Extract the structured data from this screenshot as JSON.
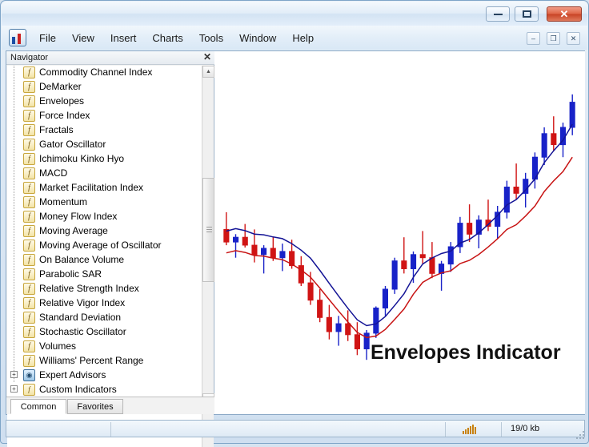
{
  "window": {
    "title": "",
    "buttons": {
      "minimize": "minimize",
      "maximize": "maximize",
      "close": "✕"
    }
  },
  "menu": {
    "items": [
      {
        "label": "File"
      },
      {
        "label": "View"
      },
      {
        "label": "Insert"
      },
      {
        "label": "Charts"
      },
      {
        "label": "Tools"
      },
      {
        "label": "Window"
      },
      {
        "label": "Help"
      }
    ],
    "mdi_buttons": {
      "minimize": "–",
      "restore": "❐",
      "close": "✕"
    }
  },
  "navigator": {
    "title": "Navigator",
    "close_label": "✕",
    "indicator_glyph": "f",
    "items": [
      {
        "label": "Commodity Channel Index",
        "type": "indicator"
      },
      {
        "label": "DeMarker",
        "type": "indicator"
      },
      {
        "label": "Envelopes",
        "type": "indicator"
      },
      {
        "label": "Force Index",
        "type": "indicator"
      },
      {
        "label": "Fractals",
        "type": "indicator"
      },
      {
        "label": "Gator Oscillator",
        "type": "indicator"
      },
      {
        "label": "Ichimoku Kinko Hyo",
        "type": "indicator"
      },
      {
        "label": "MACD",
        "type": "indicator"
      },
      {
        "label": "Market Facilitation Index",
        "type": "indicator"
      },
      {
        "label": "Momentum",
        "type": "indicator"
      },
      {
        "label": "Money Flow Index",
        "type": "indicator"
      },
      {
        "label": "Moving Average",
        "type": "indicator"
      },
      {
        "label": "Moving Average of Oscillator",
        "type": "indicator"
      },
      {
        "label": "On Balance Volume",
        "type": "indicator"
      },
      {
        "label": "Parabolic SAR",
        "type": "indicator"
      },
      {
        "label": "Relative Strength Index",
        "type": "indicator"
      },
      {
        "label": "Relative Vigor Index",
        "type": "indicator"
      },
      {
        "label": "Standard Deviation",
        "type": "indicator"
      },
      {
        "label": "Stochastic Oscillator",
        "type": "indicator"
      },
      {
        "label": "Volumes",
        "type": "indicator"
      },
      {
        "label": "Williams' Percent Range",
        "type": "indicator"
      },
      {
        "label": "Expert Advisors",
        "type": "group",
        "expander": "+"
      },
      {
        "label": "Custom Indicators",
        "type": "group-yellow",
        "expander": "+"
      }
    ],
    "tabs": [
      {
        "label": "Common",
        "active": true
      },
      {
        "label": "Favorites",
        "active": false
      }
    ]
  },
  "chart": {
    "label": "Envelopes Indicator",
    "colors": {
      "bull": "#1822c8",
      "bear": "#d01414",
      "upper_band": "#141496",
      "lower_band": "#c81414"
    }
  },
  "status_bar": {
    "size_text": "19/0 kb",
    "signal_icon": "signal-bars"
  },
  "chart_data": {
    "type": "candlestick",
    "title": "Envelopes Indicator",
    "xlabel": "",
    "ylabel": "",
    "grid": false,
    "candles": [
      {
        "open": 268,
        "high": 290,
        "low": 248,
        "close": 252,
        "dir": "down"
      },
      {
        "open": 252,
        "high": 262,
        "low": 232,
        "close": 258,
        "dir": "up"
      },
      {
        "open": 258,
        "high": 275,
        "low": 245,
        "close": 248,
        "dir": "down"
      },
      {
        "open": 248,
        "high": 268,
        "low": 226,
        "close": 236,
        "dir": "down"
      },
      {
        "open": 236,
        "high": 248,
        "low": 212,
        "close": 244,
        "dir": "up"
      },
      {
        "open": 244,
        "high": 258,
        "low": 228,
        "close": 232,
        "dir": "down"
      },
      {
        "open": 232,
        "high": 250,
        "low": 215,
        "close": 240,
        "dir": "up"
      },
      {
        "open": 240,
        "high": 255,
        "low": 218,
        "close": 222,
        "dir": "down"
      },
      {
        "open": 222,
        "high": 234,
        "low": 196,
        "close": 200,
        "dir": "down"
      },
      {
        "open": 200,
        "high": 214,
        "low": 172,
        "close": 178,
        "dir": "down"
      },
      {
        "open": 178,
        "high": 192,
        "low": 150,
        "close": 156,
        "dir": "down"
      },
      {
        "open": 156,
        "high": 172,
        "low": 128,
        "close": 138,
        "dir": "down"
      },
      {
        "open": 138,
        "high": 158,
        "low": 120,
        "close": 148,
        "dir": "up"
      },
      {
        "open": 148,
        "high": 165,
        "low": 126,
        "close": 134,
        "dir": "down"
      },
      {
        "open": 134,
        "high": 150,
        "low": 108,
        "close": 116,
        "dir": "down"
      },
      {
        "open": 116,
        "high": 140,
        "low": 102,
        "close": 136,
        "dir": "up"
      },
      {
        "open": 136,
        "high": 170,
        "low": 130,
        "close": 168,
        "dir": "up"
      },
      {
        "open": 168,
        "high": 196,
        "low": 158,
        "close": 192,
        "dir": "up"
      },
      {
        "open": 192,
        "high": 232,
        "low": 186,
        "close": 228,
        "dir": "up"
      },
      {
        "open": 228,
        "high": 258,
        "low": 212,
        "close": 218,
        "dir": "down"
      },
      {
        "open": 218,
        "high": 240,
        "low": 200,
        "close": 236,
        "dir": "up"
      },
      {
        "open": 236,
        "high": 266,
        "low": 224,
        "close": 232,
        "dir": "down"
      },
      {
        "open": 232,
        "high": 252,
        "low": 206,
        "close": 212,
        "dir": "down"
      },
      {
        "open": 212,
        "high": 228,
        "low": 190,
        "close": 224,
        "dir": "up"
      },
      {
        "open": 224,
        "high": 252,
        "low": 214,
        "close": 246,
        "dir": "up"
      },
      {
        "open": 246,
        "high": 284,
        "low": 238,
        "close": 276,
        "dir": "up"
      },
      {
        "open": 276,
        "high": 300,
        "low": 252,
        "close": 262,
        "dir": "down"
      },
      {
        "open": 262,
        "high": 286,
        "low": 244,
        "close": 280,
        "dir": "up"
      },
      {
        "open": 280,
        "high": 306,
        "low": 266,
        "close": 272,
        "dir": "down"
      },
      {
        "open": 272,
        "high": 298,
        "low": 256,
        "close": 290,
        "dir": "up"
      },
      {
        "open": 290,
        "high": 330,
        "low": 282,
        "close": 322,
        "dir": "up"
      },
      {
        "open": 322,
        "high": 352,
        "low": 306,
        "close": 314,
        "dir": "down"
      },
      {
        "open": 314,
        "high": 340,
        "low": 296,
        "close": 332,
        "dir": "up"
      },
      {
        "open": 332,
        "high": 366,
        "low": 320,
        "close": 360,
        "dir": "up"
      },
      {
        "open": 360,
        "high": 398,
        "low": 350,
        "close": 390,
        "dir": "up"
      },
      {
        "open": 390,
        "high": 412,
        "low": 368,
        "close": 376,
        "dir": "down"
      },
      {
        "open": 376,
        "high": 404,
        "low": 360,
        "close": 398,
        "dir": "up"
      },
      {
        "open": 398,
        "high": 440,
        "low": 388,
        "close": 430,
        "dir": "up"
      }
    ],
    "series": [
      {
        "name": "Upper Envelope",
        "color": "#141496"
      },
      {
        "name": "Lower Envelope",
        "color": "#c81414"
      }
    ]
  }
}
